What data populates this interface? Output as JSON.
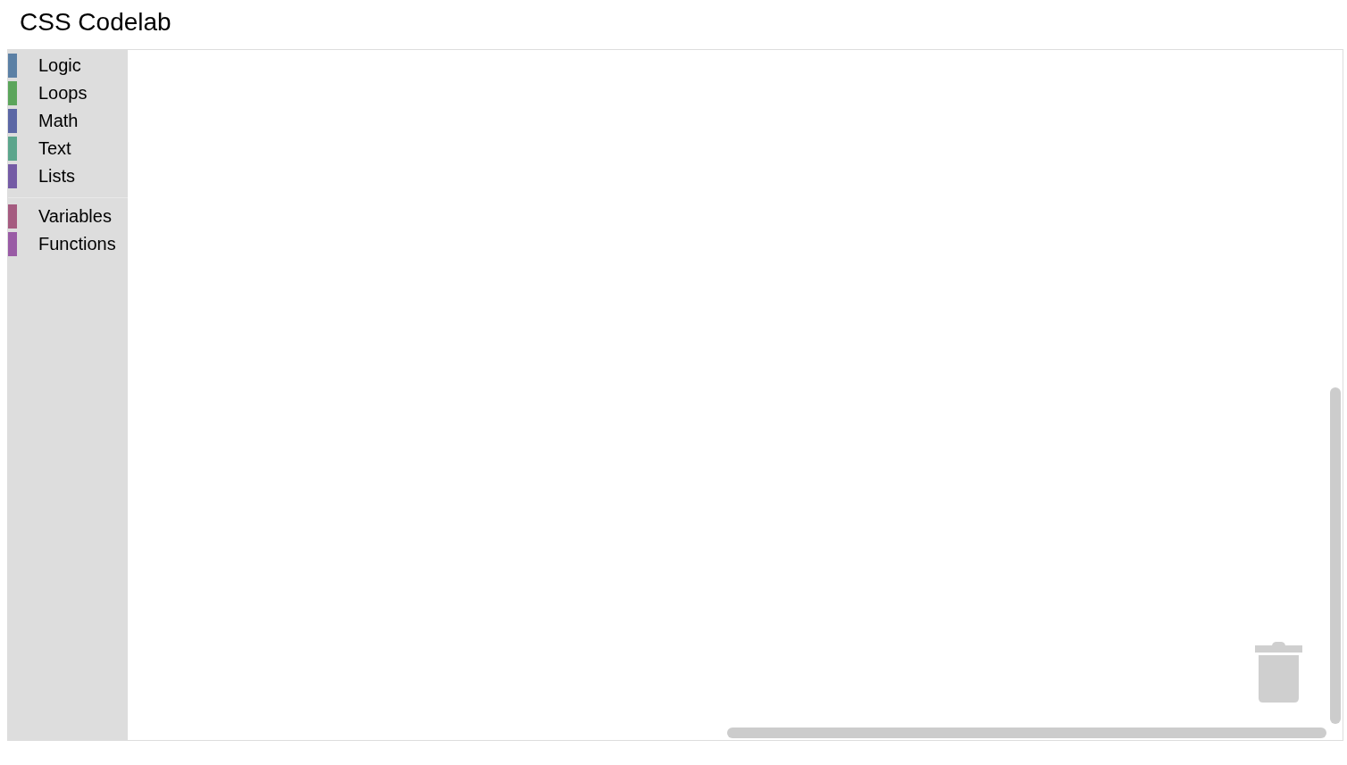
{
  "title": "CSS Codelab",
  "toolbox": {
    "groups": [
      {
        "categories": [
          {
            "label": "Logic",
            "color": "#5b80a5",
            "selected": false
          },
          {
            "label": "Loops",
            "color": "#5ba55b",
            "selected": false
          },
          {
            "label": "Math",
            "color": "#5b67a5",
            "selected": false
          },
          {
            "label": "Text",
            "color": "#5ba58c",
            "selected": false
          },
          {
            "label": "Lists",
            "color": "#745ba5",
            "selected": false
          }
        ]
      },
      {
        "categories": [
          {
            "label": "Variables",
            "color": "#a55b80",
            "selected": false
          },
          {
            "label": "Functions",
            "color": "#995ba5",
            "selected": false
          }
        ]
      }
    ]
  }
}
